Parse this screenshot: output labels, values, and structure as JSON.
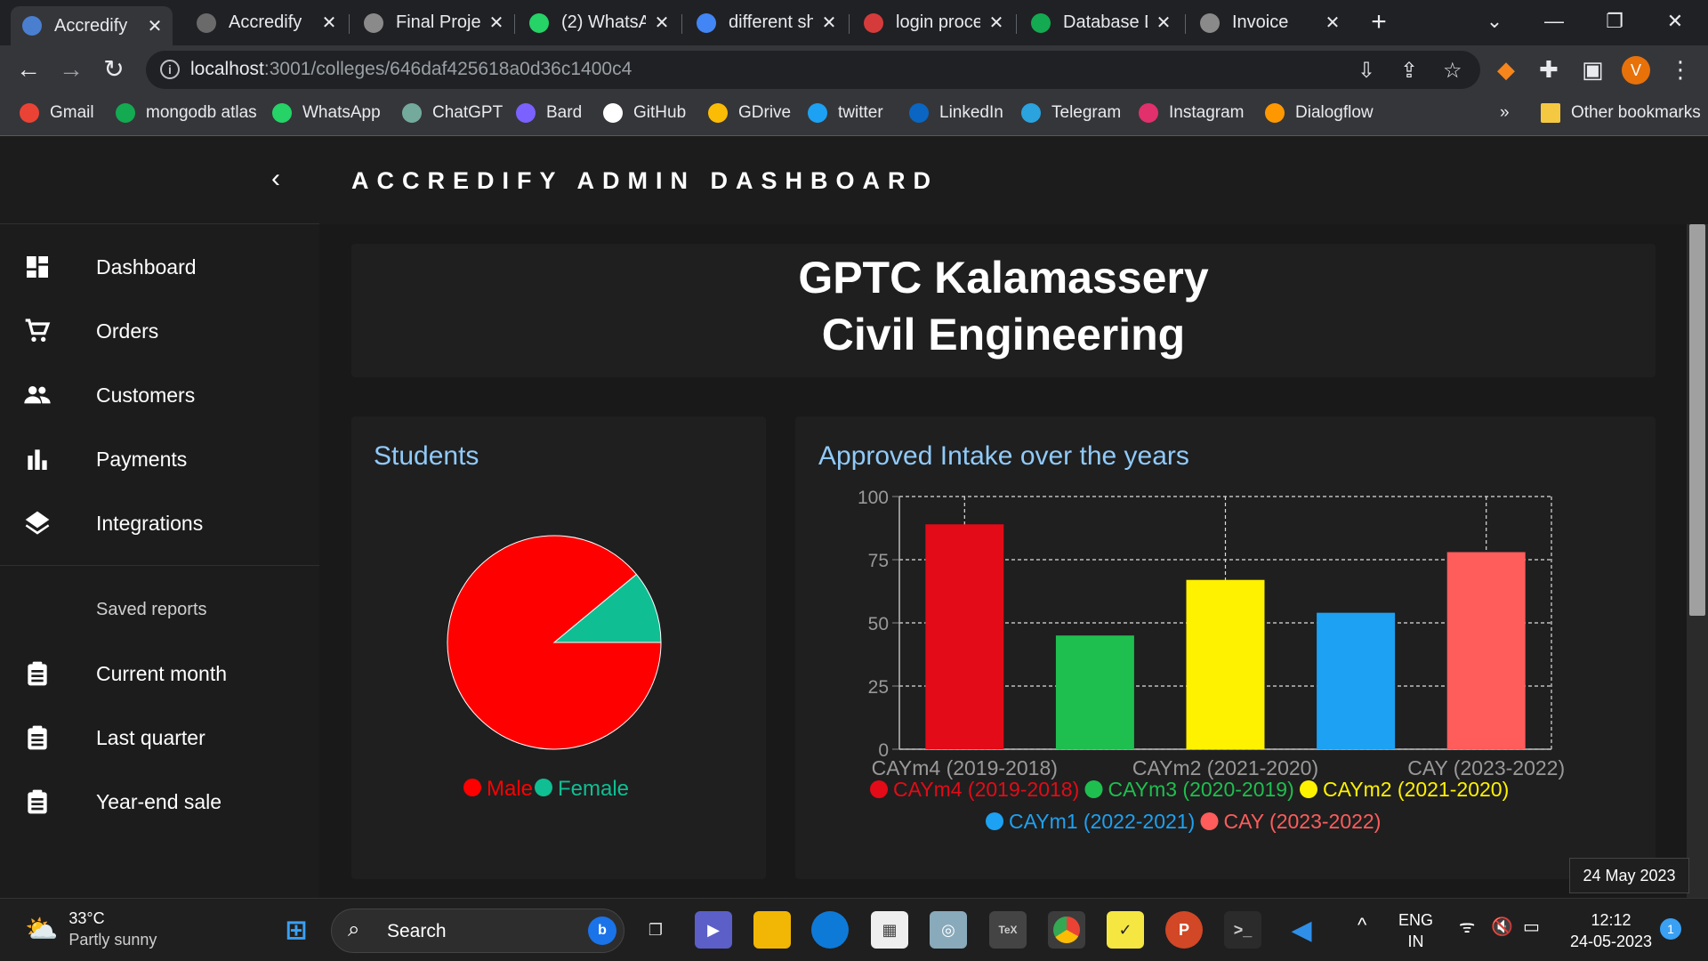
{
  "browser": {
    "tabs": [
      {
        "title": "Accredify",
        "active": true
      },
      {
        "title": "Accredify",
        "active": false
      },
      {
        "title": "Final Projec",
        "active": false
      },
      {
        "title": "(2) WhatsA",
        "active": false
      },
      {
        "title": "different sh",
        "active": false
      },
      {
        "title": "login proce",
        "active": false
      },
      {
        "title": "Database D",
        "active": false
      },
      {
        "title": "Invoice",
        "active": false
      }
    ],
    "url_host": "localhost",
    "url_path": ":3001/colleges/646daf425618a0d36c1400c4",
    "avatar_letter": "V",
    "bookmarks": [
      "Gmail",
      "mongodb atlas",
      "WhatsApp",
      "ChatGPT",
      "Bard",
      "GitHub",
      "GDrive",
      "twitter",
      "LinkedIn",
      "Telegram",
      "Instagram",
      "Dialogflow"
    ],
    "other_bookmarks": "Other bookmarks",
    "overflow": "»"
  },
  "sidebar": {
    "items": [
      {
        "label": "Dashboard",
        "icon": "dashboard-icon"
      },
      {
        "label": "Orders",
        "icon": "cart-icon"
      },
      {
        "label": "Customers",
        "icon": "people-icon"
      },
      {
        "label": "Payments",
        "icon": "bar-chart-icon"
      },
      {
        "label": "Integrations",
        "icon": "layers-icon"
      }
    ],
    "saved_title": "Saved reports",
    "reports": [
      {
        "label": "Current month",
        "icon": "clipboard-icon"
      },
      {
        "label": "Last quarter",
        "icon": "clipboard-icon"
      },
      {
        "label": "Year-end sale",
        "icon": "clipboard-icon"
      }
    ]
  },
  "header": {
    "title": "ACCREDIFY ADMIN DASHBOARD"
  },
  "college": {
    "line1": "GPTC Kalamassery",
    "line2": "Civil Engineering"
  },
  "students_card": {
    "title": "Students"
  },
  "intake_card": {
    "title": "Approved Intake over the years"
  },
  "tooltip": "24 May 2023",
  "colors": {
    "male": "#ff0000",
    "female": "#0fbf93",
    "accent_title": "#90caf9"
  },
  "chart_data": [
    {
      "type": "pie",
      "categories": [
        "Male",
        "Female"
      ],
      "values": [
        89,
        11
      ],
      "colors": [
        "#ff0000",
        "#0fbf93"
      ],
      "legend": "bottom"
    },
    {
      "type": "bar",
      "categories": [
        "CAYm4 (2019-2018)",
        "CAYm3 (2020-2019)",
        "CAYm2 (2021-2020)",
        "CAYm1 (2022-2021)",
        "CAY (2023-2022)"
      ],
      "values": [
        89,
        45,
        67,
        54,
        78
      ],
      "colors": [
        "#e30b17",
        "#1fbf4f",
        "#fff200",
        "#1da1f2",
        "#ff5c5c"
      ],
      "ylim": [
        0,
        100
      ],
      "yticks": [
        "0",
        "25",
        "50",
        "75",
        "100"
      ],
      "xticks_shown": [
        "CAYm4 (2019-2018)",
        "CAYm2 (2021-2020)",
        "CAY (2023-2022)"
      ],
      "grid": true,
      "legend": "bottom"
    }
  ],
  "taskbar": {
    "temp": "33°C",
    "weather": "Partly sunny",
    "search": "Search",
    "lang1": "ENG",
    "lang2": "IN",
    "time": "12:12",
    "date": "24-05-2023",
    "notif": "1"
  }
}
